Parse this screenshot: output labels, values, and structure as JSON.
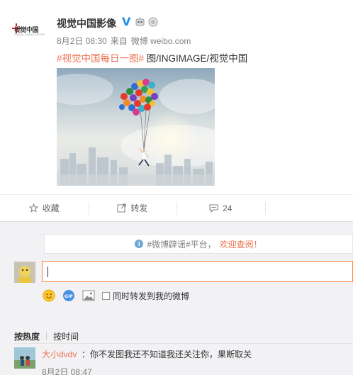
{
  "post": {
    "author": "视觉中国影像",
    "logo_text": "视觉中国",
    "logo_subtext": "VISUAL CHINA GROUP",
    "date": "8月2日 08:30",
    "source_prefix": "来自",
    "source": "微博 weibo.com",
    "hashtag": "#视觉中国每日一图#",
    "text": " 图/INGIMAGE/视觉中国",
    "image_icon": "balloon-photo"
  },
  "actions": {
    "favorite_label": "收藏",
    "repost_label": "转发",
    "comment_count": "24",
    "like_label": ""
  },
  "notice": {
    "prefix": "#微博辟谣#平台，",
    "link": "欢迎查阅！"
  },
  "composer": {
    "input_value": "",
    "repost_label": "同时转发到我的微博"
  },
  "sort": {
    "hot": "按热度",
    "time": "按时间",
    "separator": "|"
  },
  "comments": [
    {
      "user": "大小dvdv",
      "text": "：你不发图我还不知道我还关注你，果断取关",
      "time": "8月2日 08:47"
    }
  ],
  "colors": {
    "accent": "#eb7350",
    "verified": "#1f8fe4",
    "input_border": "#ff8140"
  }
}
